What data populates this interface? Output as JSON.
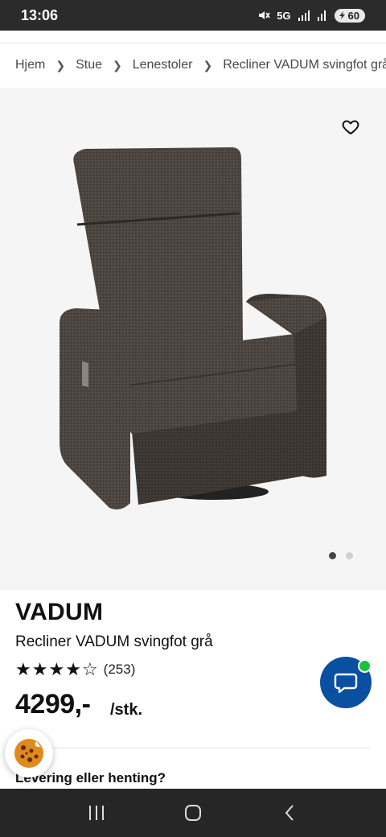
{
  "status_bar": {
    "time": "13:06",
    "network": "5G",
    "battery": "60",
    "icons": [
      "mute-icon",
      "signal-icon",
      "signal-icon",
      "battery-icon"
    ]
  },
  "breadcrumb": {
    "items": [
      "Hjem",
      "Stue",
      "Lenestoler",
      "Recliner VADUM svingfot grå"
    ]
  },
  "product": {
    "brand": "VADUM",
    "name": "Recliner VADUM svingfot grå",
    "rating_stars": 4,
    "rating_max": 5,
    "rating_count": "(253)",
    "price": "4299,-",
    "unit": "/stk."
  },
  "gallery": {
    "image_count": 2,
    "active_index": 0
  },
  "sections": {
    "delivery_heading": "Levering eller henting?"
  },
  "colors": {
    "accent_blue": "#0a4fa0",
    "online_green": "#16c33a",
    "hero_bg": "#f5f5f5"
  }
}
